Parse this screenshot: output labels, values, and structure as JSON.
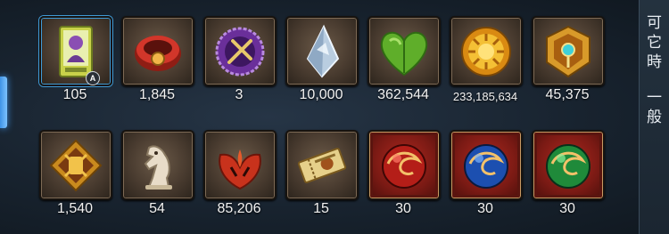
{
  "right_panel": {
    "chars": [
      "可",
      "它",
      "時",
      "一",
      "般"
    ]
  },
  "rows": [
    [
      {
        "icon": "portrait-card-icon",
        "quantity": "105",
        "badge": "A",
        "selected": true
      },
      {
        "icon": "red-bracelet-icon",
        "quantity": "1,845"
      },
      {
        "icon": "purple-seal-icon",
        "quantity": "3"
      },
      {
        "icon": "crystal-shard-icon",
        "quantity": "10,000"
      },
      {
        "icon": "green-heart-leaf-icon",
        "quantity": "362,544"
      },
      {
        "icon": "sun-coin-icon",
        "quantity": "233,185,634"
      },
      {
        "icon": "gold-gem-emblem-icon",
        "quantity": "45,375"
      }
    ],
    [
      {
        "icon": "fist-emblem-icon",
        "quantity": "1,540"
      },
      {
        "icon": "chess-knight-icon",
        "quantity": "54"
      },
      {
        "icon": "red-leaf-sigil-icon",
        "quantity": "85,206"
      },
      {
        "icon": "ticket-icon",
        "quantity": "15"
      },
      {
        "icon": "red-orb-icon",
        "quantity": "30"
      },
      {
        "icon": "blue-orb-icon",
        "quantity": "30"
      },
      {
        "icon": "green-orb-icon",
        "quantity": "30"
      }
    ]
  ],
  "colors": {
    "accent": "#3f93e6",
    "slot_border": "#17130f",
    "text": "#f2f2f2"
  }
}
